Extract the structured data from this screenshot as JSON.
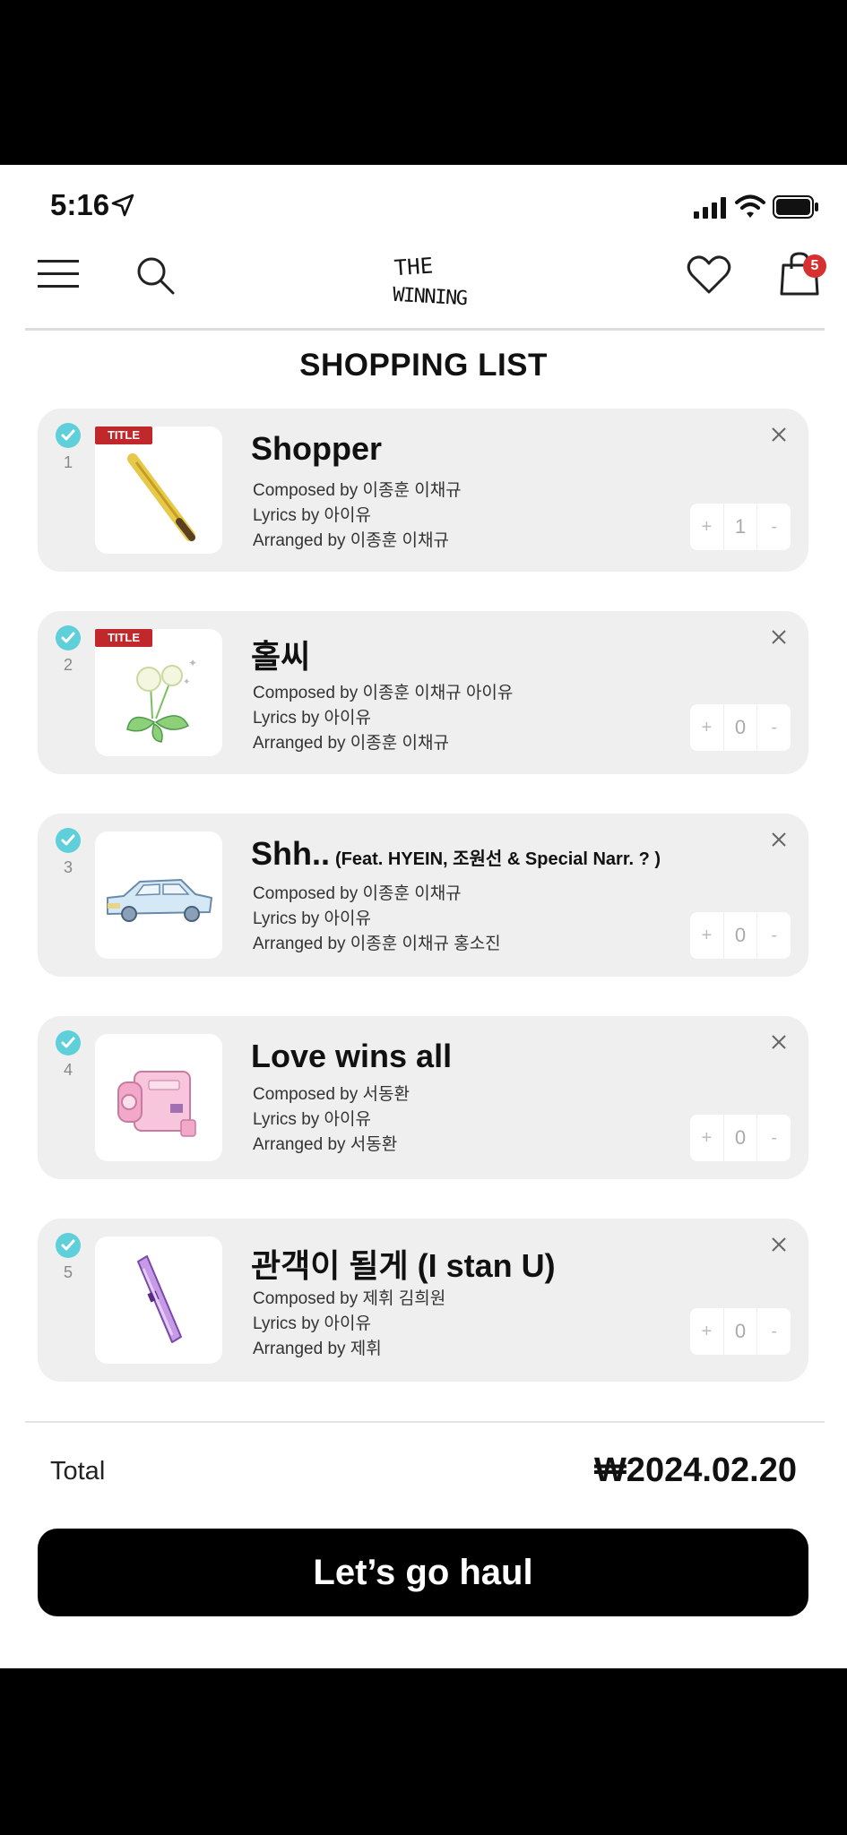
{
  "status_bar": {
    "time": "5:16"
  },
  "header": {
    "logo_line1": "THE",
    "logo_line2": "WINNING",
    "cart_count": "5"
  },
  "page_title": "SHOPPING LIST",
  "items": [
    {
      "number": "1",
      "title": "Shopper",
      "feat": "",
      "tag": "TITLE",
      "composed": "Composed by 이종훈 이채규",
      "lyrics": "Lyrics by 아이유",
      "arranged": "Arranged by 이종훈 이채규",
      "quantity": "1",
      "image": "baseball-bat"
    },
    {
      "number": "2",
      "title": "홀씨",
      "feat": "",
      "tag": "TITLE",
      "composed": "Composed by 이종훈 이채규 아이유",
      "lyrics": "Lyrics by 아이유",
      "arranged": "Arranged by 이종훈 이채규",
      "quantity": "0",
      "image": "dandelion"
    },
    {
      "number": "3",
      "title": "Shh..",
      "feat": "(Feat. HYEIN, 조원선 & Special Narr. ? )",
      "tag": "",
      "composed": "Composed by 이종훈 이채규",
      "lyrics": "Lyrics by 아이유",
      "arranged": "Arranged by 이종훈 이채규 홍소진",
      "quantity": "0",
      "image": "car"
    },
    {
      "number": "4",
      "title": "Love wins all",
      "feat": "",
      "tag": "",
      "composed": "Composed by 서동환",
      "lyrics": "Lyrics by 아이유",
      "arranged": "Arranged by 서동환",
      "quantity": "0",
      "image": "camcorder"
    },
    {
      "number": "5",
      "title": "관객이 될게 (I stan U)",
      "feat": "",
      "tag": "",
      "composed": "Composed by 제휘 김희원",
      "lyrics": "Lyrics by 아이유",
      "arranged": "Arranged by 제휘",
      "quantity": "0",
      "image": "lightstick"
    }
  ],
  "stepper": {
    "plus": "+",
    "minus": "-"
  },
  "total": {
    "label": "Total",
    "value": "₩2024.02.20"
  },
  "cta_label": "Let’s go haul",
  "colors": {
    "check": "#5fcfda",
    "tag": "#c0282c",
    "badge": "#d63030"
  }
}
